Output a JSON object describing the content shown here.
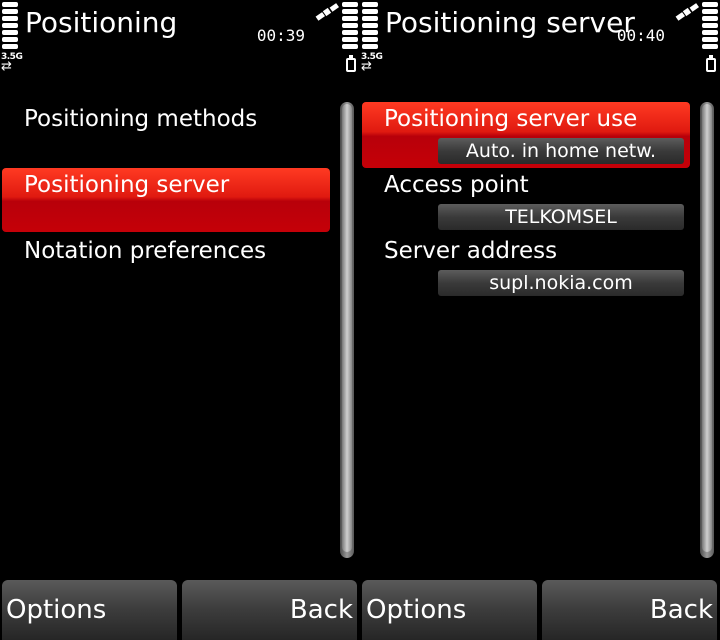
{
  "left": {
    "title": "Positioning",
    "time": "00:39",
    "network": "3.5G",
    "items": [
      {
        "label": "Positioning methods"
      },
      {
        "label": "Positioning server"
      },
      {
        "label": "Notation preferences"
      }
    ],
    "selected_index": 1,
    "softkeys": {
      "left": "Options",
      "right": "Back"
    }
  },
  "right": {
    "title": "Positioning server",
    "time": "00:40",
    "network": "3.5G",
    "settings": [
      {
        "label": "Positioning server use",
        "value": "Auto. in home netw."
      },
      {
        "label": "Access point",
        "value": "TELKOMSEL"
      },
      {
        "label": "Server address",
        "value": "supl.nokia.com"
      }
    ],
    "selected_index": 0,
    "softkeys": {
      "left": "Options",
      "right": "Back"
    }
  },
  "colors": {
    "highlight": "#e01a10",
    "background": "#000000",
    "field": "#3a3a3a"
  },
  "icons": [
    "signal-strength-icon",
    "network-type-icon",
    "data-transfer-icon",
    "gps-satellite-icon",
    "battery-level-icon",
    "battery-icon"
  ]
}
